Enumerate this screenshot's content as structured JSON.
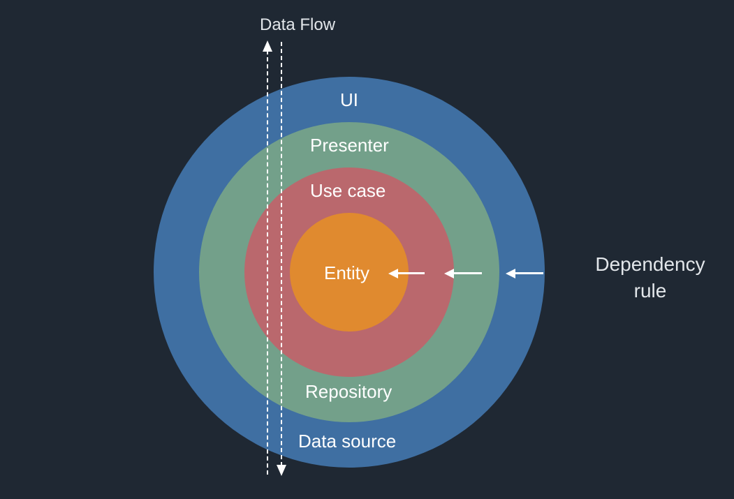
{
  "title": "Data Flow",
  "dependency_label_line1": "Dependency",
  "dependency_label_line2": "rule",
  "layers": {
    "ui": "UI",
    "presenter": "Presenter",
    "usecase": "Use case",
    "entity": "Entity",
    "repository": "Repository",
    "datasource": "Data source"
  },
  "colors": {
    "background": "#1f2833",
    "ui": "#3f6fa2",
    "presenter": "#73a08a",
    "usecase": "#ba686d",
    "entity": "#e08a2f",
    "text": "#ffffff"
  },
  "diagram": {
    "type": "concentric-layer-architecture",
    "data_flow_direction": "bidirectional-vertical",
    "dependency_direction": "outer-to-inner"
  }
}
